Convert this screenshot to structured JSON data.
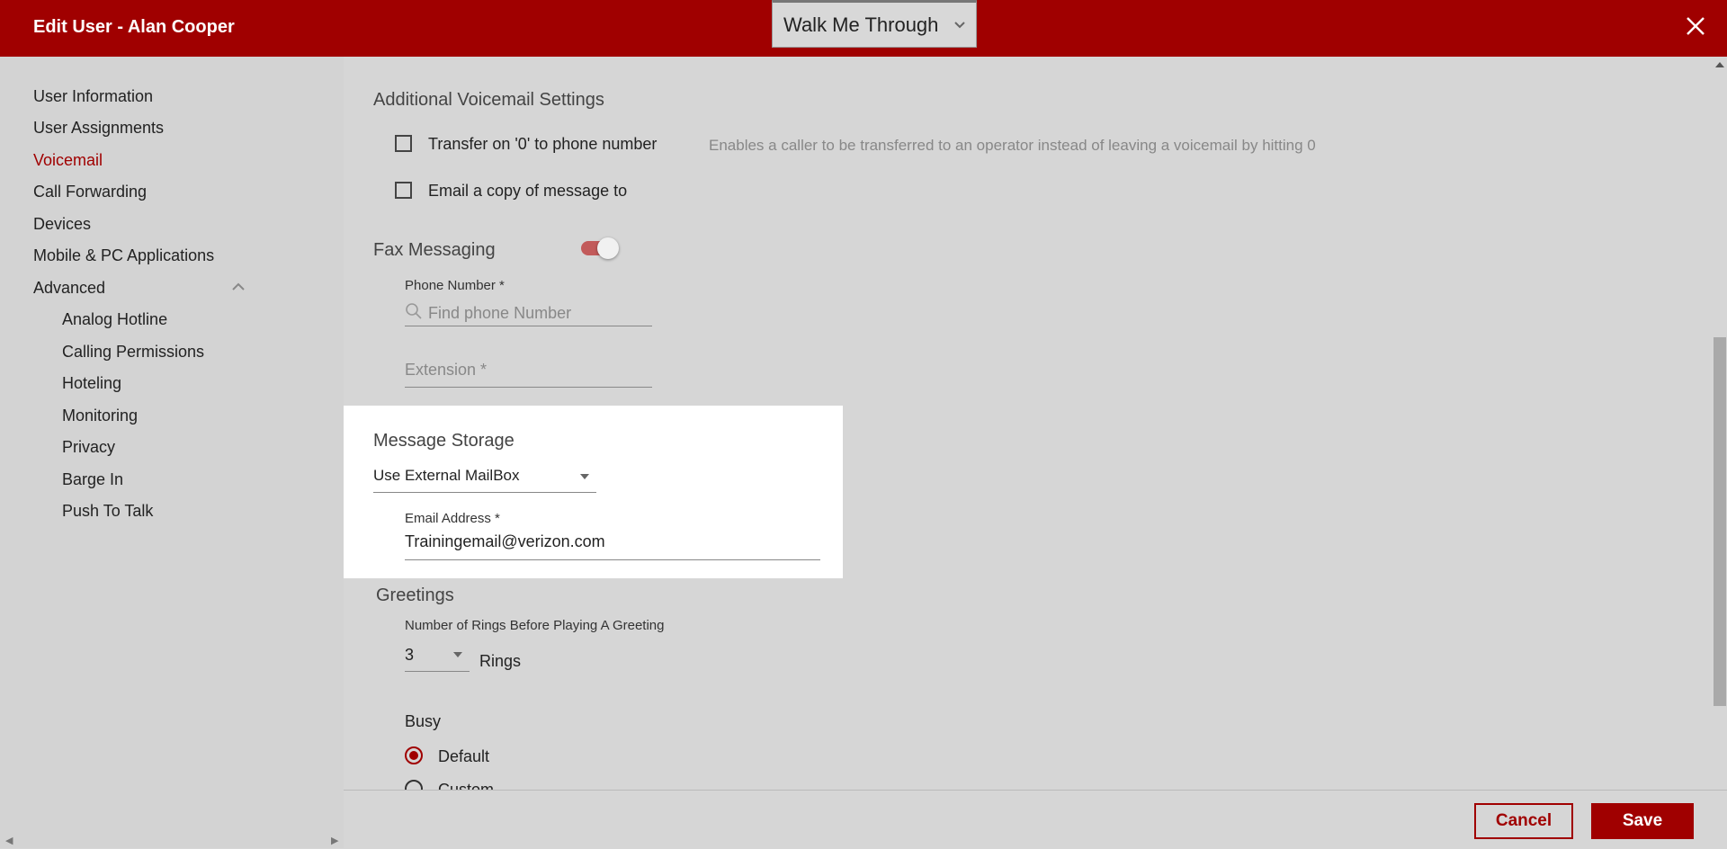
{
  "header": {
    "title": "Edit User - Alan Cooper",
    "walk_me_label": "Walk Me Through"
  },
  "sidebar": {
    "items": [
      {
        "label": "User Information"
      },
      {
        "label": "User Assignments"
      },
      {
        "label": "Voicemail",
        "active": true
      },
      {
        "label": "Call Forwarding"
      },
      {
        "label": "Devices"
      },
      {
        "label": "Mobile & PC Applications"
      },
      {
        "label": "Advanced",
        "expanded": true
      }
    ],
    "advanced_items": [
      {
        "label": "Analog Hotline"
      },
      {
        "label": "Calling Permissions"
      },
      {
        "label": "Hoteling"
      },
      {
        "label": "Monitoring"
      },
      {
        "label": "Privacy"
      },
      {
        "label": "Barge In"
      },
      {
        "label": "Push To Talk"
      }
    ]
  },
  "main": {
    "additional_title": "Additional Voicemail Settings",
    "transfer_label": "Transfer on '0' to phone number",
    "transfer_checked": false,
    "transfer_hint": "Enables a caller to be transferred to an operator instead of leaving a voicemail by hitting 0",
    "email_copy_label": "Email a copy of message to",
    "email_copy_checked": false,
    "fax_title": "Fax Messaging",
    "fax_enabled": true,
    "phone_number_label": "Phone Number *",
    "phone_number_placeholder": "Find phone Number",
    "extension_placeholder": "Extension *",
    "storage_title": "Message Storage",
    "storage_value": "Use External MailBox",
    "email_address_label": "Email Address *",
    "email_address_value": "Trainingemail@verizon.com",
    "greetings_title": "Greetings",
    "rings_label": "Number of Rings Before Playing A Greeting",
    "rings_value": "3",
    "rings_suffix": "Rings",
    "busy_label": "Busy",
    "busy_default_label": "Default",
    "busy_custom_label": "Custom",
    "busy_selected": "Default"
  },
  "footer": {
    "cancel_label": "Cancel",
    "save_label": "Save"
  },
  "colors": {
    "brand": "#a00000",
    "highlight_card": "#ffffff",
    "overlay_gray": "#d6d6d6"
  },
  "icons": [
    "chevron-down-icon",
    "close-icon",
    "chevron-up-icon",
    "search-icon"
  ]
}
